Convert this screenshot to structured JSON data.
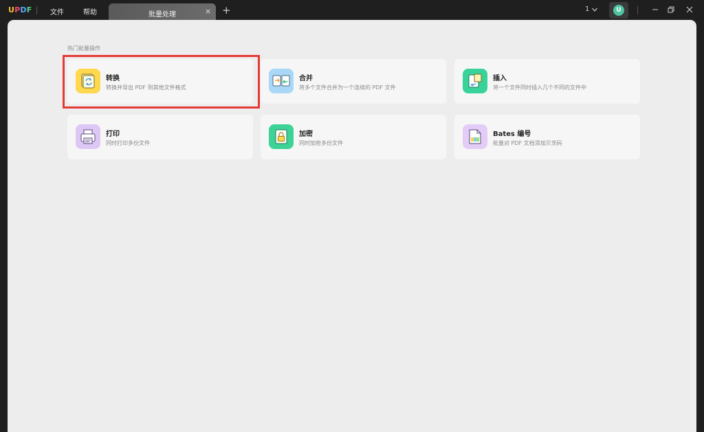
{
  "app": {
    "logo": {
      "u": "U",
      "p": "P",
      "d": "D",
      "f": "F"
    },
    "menu": [
      {
        "label": "文件"
      },
      {
        "label": "帮助"
      }
    ],
    "tab": {
      "label": "批量处理",
      "close": "×"
    },
    "add_tab": "+",
    "page_indicator": "1",
    "avatar_letter": "U"
  },
  "main": {
    "section_title": "热门批量操作",
    "cards": [
      {
        "title": "转换",
        "desc": "转换并导出 PDF 到其他文件格式",
        "icon": "convert-icon",
        "color": "#ffd84d"
      },
      {
        "title": "合并",
        "desc": "将多个文件合并为一个连续的 PDF 文件",
        "icon": "merge-icon",
        "color": "#a9d8f7"
      },
      {
        "title": "插入",
        "desc": "将一个文件同时插入几个不同的文件中",
        "icon": "insert-icon",
        "color": "#37d39a"
      },
      {
        "title": "打印",
        "desc": "同时打印多份文件",
        "icon": "print-icon",
        "color": "#dcc7f5"
      },
      {
        "title": "加密",
        "desc": "同时加密多份文件",
        "icon": "lock-icon",
        "color": "#3dd397"
      },
      {
        "title": "Bates 编号",
        "desc": "批量对 PDF 文档添加贝茨码",
        "icon": "bates-number-icon",
        "color": "#e3cdf7"
      }
    ]
  }
}
